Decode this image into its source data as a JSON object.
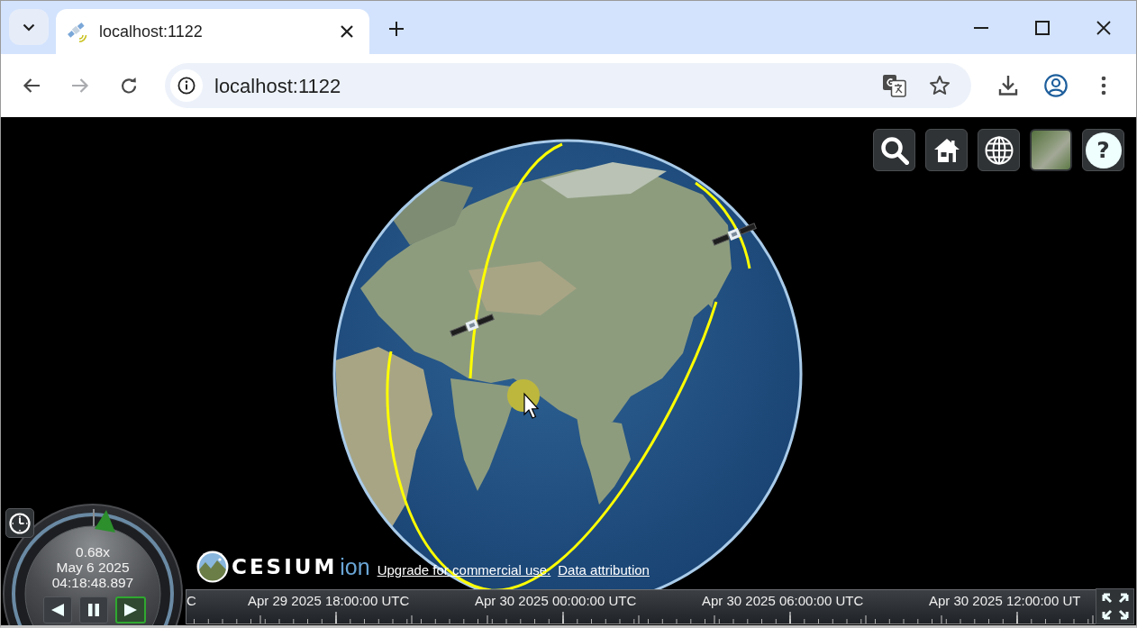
{
  "browser": {
    "tabs": [
      {
        "title": "localhost:1122",
        "selected": true
      }
    ],
    "nav_buttons": [
      {
        "kind": "back",
        "disabled": false
      },
      {
        "kind": "forward",
        "disabled": true
      },
      {
        "kind": "reload",
        "disabled": false
      }
    ],
    "address_bar": {
      "url": "localhost:1122"
    }
  },
  "viewer": {
    "help_button": {
      "label": "?"
    },
    "animation": {
      "speed": "0.68x",
      "date": "May 6 2025",
      "time": "04:18:48.897",
      "buttons": [
        {
          "kind": "reverse",
          "selected": false
        },
        {
          "kind": "pause",
          "selected": false
        },
        {
          "kind": "play",
          "selected": true
        }
      ]
    },
    "credits": {
      "logo_text": "CESIUM",
      "logo_suffix": "ion",
      "links": [
        "Upgrade for commercial use.",
        "Data attribution"
      ]
    },
    "timeline": {
      "labels": [
        "C",
        "Apr 29 2025 18:00:00 UTC",
        "Apr 30 2025 00:00:00 UTC",
        "Apr 30 2025 06:00:00 UTC",
        "Apr 30 2025 12:00:00 UT"
      ]
    }
  }
}
